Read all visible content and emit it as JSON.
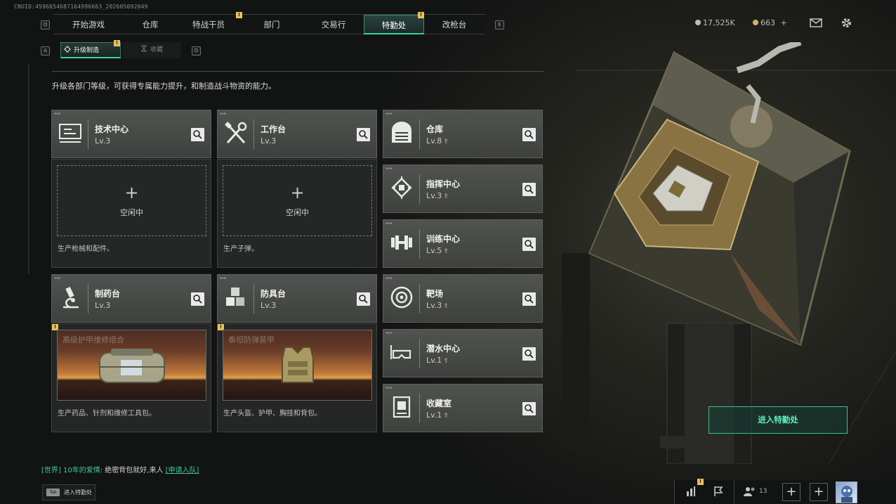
{
  "uid": "CNUID:4596654687164996663_202605092049",
  "nav": {
    "hint_left": "Q",
    "hint_right": "E",
    "tabs": [
      {
        "label": "开始游戏",
        "badge": ""
      },
      {
        "label": "仓库",
        "badge": ""
      },
      {
        "label": "特战干员",
        "badge": "!"
      },
      {
        "label": "部门",
        "badge": ""
      },
      {
        "label": "交易行",
        "badge": ""
      },
      {
        "label": "特勤处",
        "badge": "!",
        "active": true
      },
      {
        "label": "改枪台",
        "badge": ""
      }
    ]
  },
  "subnav": {
    "hint_left": "A",
    "hint_right": "D",
    "tabs": [
      {
        "label": "升级制造",
        "badge": "!",
        "active": true
      },
      {
        "label": "收藏",
        "badge": ""
      }
    ]
  },
  "description": "升级各部门等级，可获得专属能力提升，和制造战斗物资的能力。",
  "workshops": [
    {
      "name": "技术中心",
      "level": "Lv.3",
      "icon": "circuit-board-icon",
      "slot": "idle",
      "idle_label": "空闲中",
      "produces": "生产枪械和配件。"
    },
    {
      "name": "工作台",
      "level": "Lv.3",
      "icon": "tools-icon",
      "slot": "idle",
      "idle_label": "空闲中",
      "produces": "生产子弹。"
    },
    {
      "name": "制药台",
      "level": "Lv.3",
      "icon": "microscope-icon",
      "slot": "item",
      "item_name": "高级护甲维修组合",
      "item_badge": "!",
      "produces": "生产药品、针剂和维修工具包。"
    },
    {
      "name": "防具台",
      "level": "Lv.3",
      "icon": "armor-blocks-icon",
      "slot": "item",
      "item_name": "泰坦防弹装甲",
      "item_badge": "!",
      "produces": "生产头盔、护甲、胸挂和背包。"
    }
  ],
  "departments": [
    {
      "name": "仓库",
      "level": "Lv.8",
      "icon": "warehouse-icon",
      "upgradable": true
    },
    {
      "name": "指挥中心",
      "level": "Lv.3",
      "icon": "chip-icon",
      "upgradable": true
    },
    {
      "name": "训练中心",
      "level": "Lv.5",
      "icon": "dumbbell-icon",
      "upgradable": true
    },
    {
      "name": "靶场",
      "level": "Lv.3",
      "icon": "target-icon",
      "upgradable": true
    },
    {
      "name": "潜水中心",
      "level": "Lv.1",
      "icon": "diving-mask-icon",
      "upgradable": true
    },
    {
      "name": "收藏室",
      "level": "Lv.1",
      "icon": "collection-icon",
      "upgradable": true
    }
  ],
  "upgrade_glyph": "⇑",
  "resources": {
    "currency": "17,525K",
    "coupon": "663",
    "coupon_add": "+"
  },
  "enter_button": "进入特勤处",
  "chat": {
    "channel": "[世界]",
    "user": "10年的爱情:",
    "message": "绝密背包就好,来人",
    "link": "[申请入队]"
  },
  "tab_button": {
    "key": "Tab",
    "label": "进入特勤处"
  },
  "bottom_bar": {
    "friends_count": "13",
    "chart_badge": "!",
    "plus": "+"
  },
  "accent": "#38d39c",
  "badge_color": "#e8c25a"
}
